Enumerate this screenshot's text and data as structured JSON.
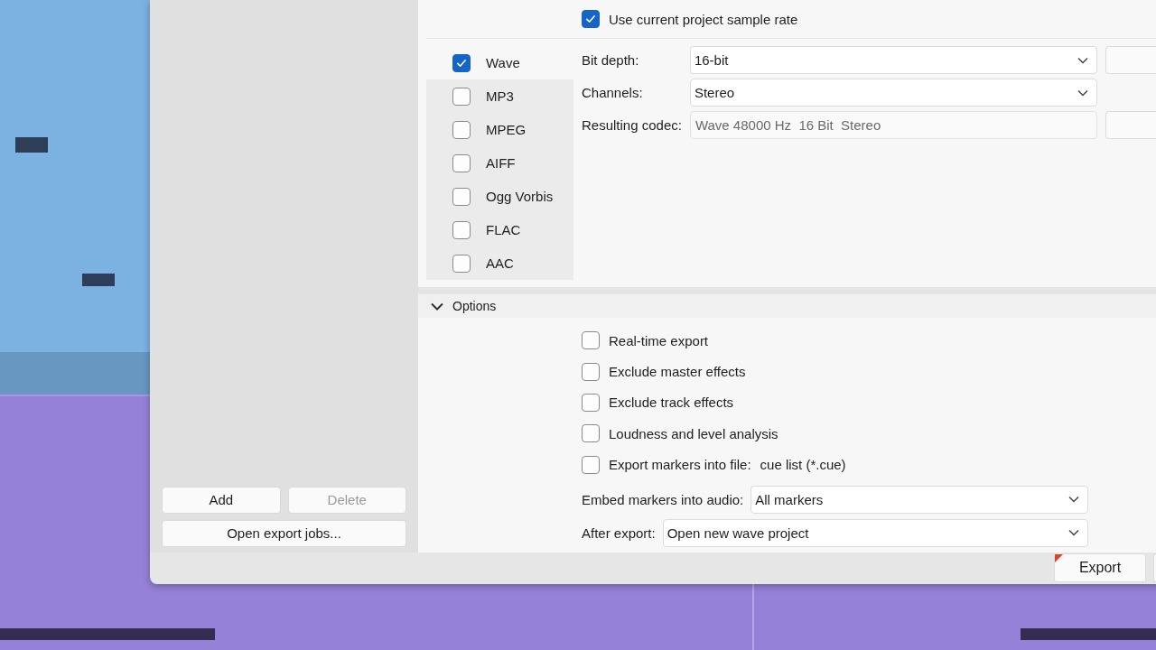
{
  "sample_rate": {
    "label": "Use current project sample rate",
    "checked": true
  },
  "formats": [
    {
      "label": "Wave",
      "checked": true,
      "selected": true
    },
    {
      "label": "MP3",
      "checked": false,
      "selected": false
    },
    {
      "label": "MPEG",
      "checked": false,
      "selected": false
    },
    {
      "label": "AIFF",
      "checked": false,
      "selected": false
    },
    {
      "label": "Ogg Vorbis",
      "checked": false,
      "selected": false
    },
    {
      "label": "FLAC",
      "checked": false,
      "selected": false
    },
    {
      "label": "AAC",
      "checked": false,
      "selected": false
    }
  ],
  "format_settings": [
    {
      "kind": "dropdown",
      "label": "Bit depth:",
      "value": "16-bit"
    },
    {
      "kind": "dropdown",
      "label": "Channels:",
      "value": "Stereo"
    },
    {
      "kind": "readonly",
      "label": "Resulting codec:",
      "value": "Wave 48000 Hz  16 Bit  Stereo"
    }
  ],
  "options": {
    "title": "Options",
    "expanded": true,
    "checkboxes": [
      {
        "label": "Real-time export",
        "checked": false
      },
      {
        "label": "Exclude master effects",
        "checked": false
      },
      {
        "label": "Exclude track effects",
        "checked": false
      },
      {
        "label": "Loudness and level analysis",
        "checked": false
      },
      {
        "label": "Export markers into file:",
        "checked": false,
        "value": "cue list (*.cue)"
      }
    ],
    "dropdowns": [
      {
        "label": "Embed markers into audio:",
        "value": "All markers"
      },
      {
        "label": "After export:",
        "value": "Open new wave project"
      }
    ]
  },
  "job_buttons": [
    {
      "label": "Add",
      "disabled": false
    },
    {
      "label": "Delete",
      "disabled": true
    }
  ],
  "open_jobs_button": {
    "label": "Open export jobs...",
    "disabled": false
  },
  "export_button": "Export"
}
